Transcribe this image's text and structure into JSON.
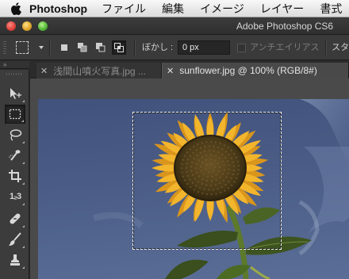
{
  "menubar": {
    "app_name": "Photoshop",
    "items": [
      "ファイル",
      "編集",
      "イメージ",
      "レイヤー",
      "書式"
    ]
  },
  "window": {
    "title": "Adobe Photoshop CS6"
  },
  "options": {
    "feather_label": "ぼかし :",
    "feather_value": "0 px",
    "antialias_label": "アンチエイリアス",
    "style_label": "スタイ"
  },
  "tabs": [
    {
      "label": "浅間山噴火写真.jpg ...",
      "active": false
    },
    {
      "label": "sunflower.jpg @ 100% (RGB/8#)",
      "active": true
    }
  ],
  "tools": {
    "collapse": "»",
    "count_tool_label": "1₂3"
  },
  "colors": {
    "sky": "#4b5d86",
    "petal": "#f0b22a",
    "center": "#4a3a1a",
    "accent_dark": "#2b2b2b"
  }
}
